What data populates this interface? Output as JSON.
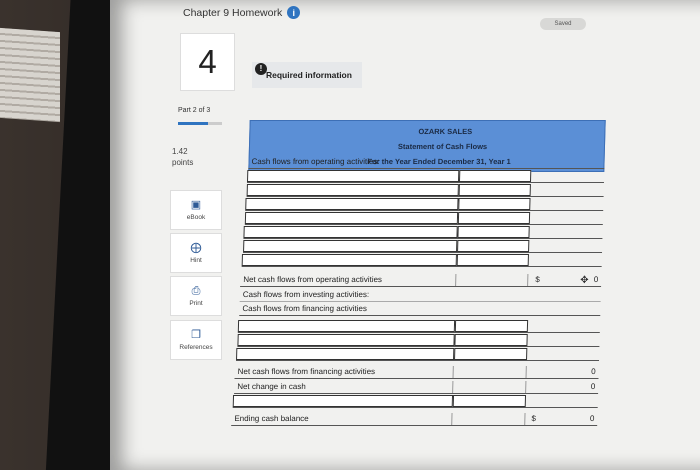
{
  "header": {
    "title": "Chapter 9 Homework",
    "saved": "Saved"
  },
  "question": {
    "number": "4",
    "alert": "Required information",
    "part": "Part 2 of 3",
    "progress": 0.67,
    "points_value": "1.42",
    "points_label": "points"
  },
  "sidebar": {
    "items": [
      {
        "label": "eBook",
        "icon": "book-icon"
      },
      {
        "label": "Hint",
        "icon": "lifebuoy-icon"
      },
      {
        "label": "Print",
        "icon": "printer-icon"
      },
      {
        "label": "References",
        "icon": "copy-icon"
      }
    ]
  },
  "worksheet": {
    "company": "OZARK SALES",
    "statement": "Statement of Cash Flows",
    "period": "For the Year Ended December 31, Year 1",
    "operating_label": "Cash flows from operating activities:",
    "net_operating": "Net cash flows from operating activities",
    "net_operating_value": "0",
    "investing_label": "Cash flows from investing activities:",
    "financing_label": "Cash flows from financing activities",
    "net_financing": "Net cash flows from financing activities",
    "net_financing_value": "0",
    "net_change": "Net change in cash",
    "net_change_value": "0",
    "ending": "Ending cash balance",
    "ending_value": "0",
    "currency": "$"
  }
}
